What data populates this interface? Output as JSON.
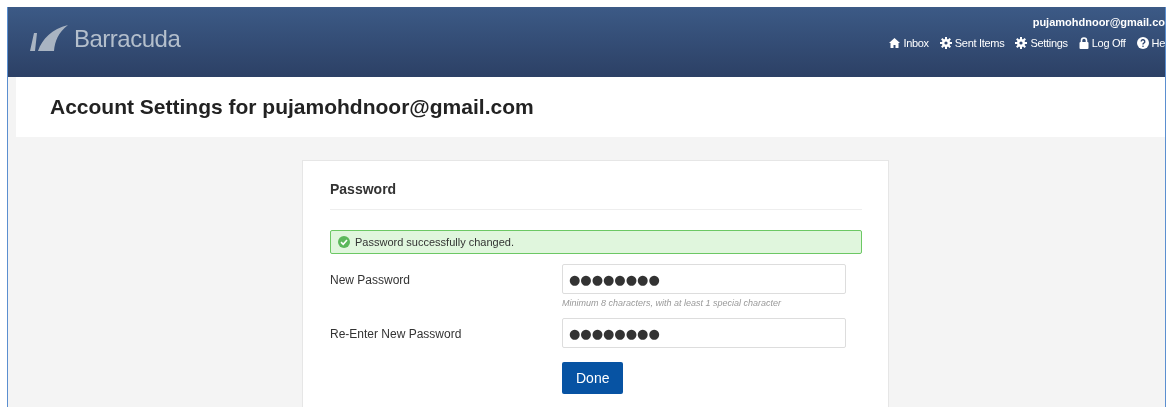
{
  "header": {
    "brand": "Barracuda",
    "user": "pujamohdnoor@gmail.co",
    "nav": [
      {
        "kind": "home",
        "label": "Inbox"
      },
      {
        "kind": "gear",
        "label": "Sent Items"
      },
      {
        "kind": "gear",
        "label": "Settings"
      },
      {
        "kind": "lock",
        "label": "Log Off"
      },
      {
        "kind": "help",
        "label": "He"
      }
    ]
  },
  "page_title": "Account Settings for pujamohdnoor@gmail.com",
  "card": {
    "title": "Password",
    "alert": "Password successfully changed.",
    "fields": [
      {
        "label": "New Password",
        "value": "●●●●●●●●",
        "hint": "Minimum 8 characters, with at least 1 special character"
      },
      {
        "label": "Re-Enter New Password",
        "value": "●●●●●●●●"
      }
    ],
    "button": "Done"
  }
}
